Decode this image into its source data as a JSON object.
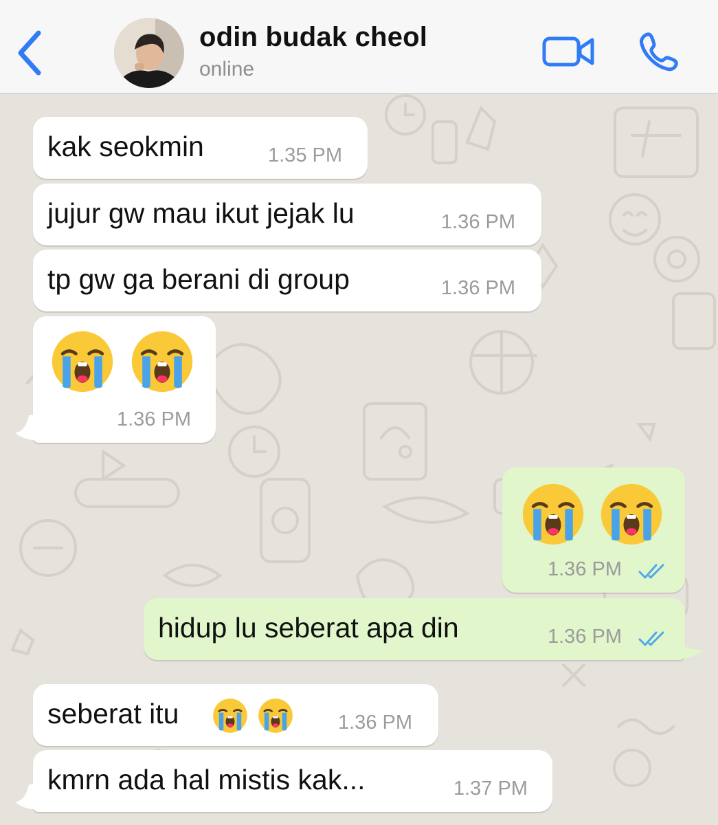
{
  "header": {
    "back_icon": "chevron-left-icon",
    "contact_name": "odin budak cheol",
    "status": "online",
    "video_icon": "video-camera-icon",
    "call_icon": "phone-icon"
  },
  "colors": {
    "accent": "#2f7cf6",
    "incoming_bubble": "#ffffff",
    "outgoing_bubble": "#e1f7cb",
    "read_ticks": "#4fa8e8",
    "wallpaper": "#e6e2dc"
  },
  "messages": [
    {
      "direction": "in",
      "text": "kak seokmin",
      "time": "1.35 PM"
    },
    {
      "direction": "in",
      "text": "jujur gw mau ikut jejak lu",
      "time": "1.36 PM"
    },
    {
      "direction": "in",
      "text": "tp gw ga berani di group",
      "time": "1.36 PM"
    },
    {
      "direction": "in",
      "emoji": [
        "loudly-crying-face",
        "loudly-crying-face"
      ],
      "time": "1.36 PM"
    },
    {
      "direction": "out",
      "emoji": [
        "loudly-crying-face",
        "loudly-crying-face"
      ],
      "time": "1.36 PM",
      "status": "read"
    },
    {
      "direction": "out",
      "text": "hidup lu seberat apa din",
      "time": "1.36 PM",
      "status": "read"
    },
    {
      "direction": "in",
      "text": "seberat itu",
      "emoji": [
        "loudly-crying-face",
        "loudly-crying-face"
      ],
      "time": "1.36 PM"
    },
    {
      "direction": "in",
      "text": "kmrn ada hal mistis kak...",
      "time": "1.37 PM"
    }
  ]
}
